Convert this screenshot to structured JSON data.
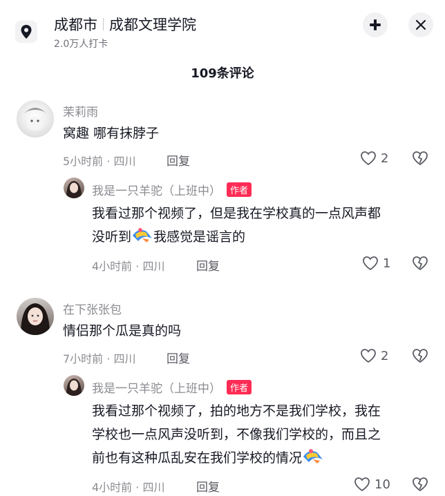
{
  "header": {
    "city": "成都市",
    "place": "成都文理学院",
    "checkins": "2.0万人打卡",
    "location_icon": "map-pin-icon",
    "collapse_icon": "collapse-icon",
    "close_icon": "close-icon"
  },
  "comments_title": "109条评论",
  "comments": [
    {
      "name": "茉莉雨",
      "text": "窝趣 哪有抹脖子",
      "meta": "5小时前 · 四川",
      "reply": "回复",
      "likes": "2",
      "reply_item": {
        "name": "我是一只羊驼（上班中）",
        "badge": "作者",
        "text1": "我看过那个视频了，但是我在学校真的一点风声都",
        "text2": "没听到",
        "text3": "我感觉是谣言的",
        "meta": "4小时前 · 四川",
        "reply": "回复",
        "likes": "1"
      }
    },
    {
      "name": "在下张张包",
      "text": "情侣那个瓜是真的吗",
      "meta": "7小时前 · 四川",
      "reply": "回复",
      "likes": "2",
      "reply_item": {
        "name": "我是一只羊驼（上班中）",
        "badge": "作者",
        "line1": "我看过那个视频了，拍的地方不是我们学校，我在",
        "line2": "学校也一点风声没听到，不像我们学校的，而且之",
        "line3": "前也有这种瓜乱安在我们学校的情况",
        "meta": "4小时前 · 四川",
        "reply": "回复",
        "likes": "10"
      }
    }
  ],
  "colors": {
    "accent": "#fe2c55",
    "muted": "#8a8b91",
    "text": "#161823"
  }
}
